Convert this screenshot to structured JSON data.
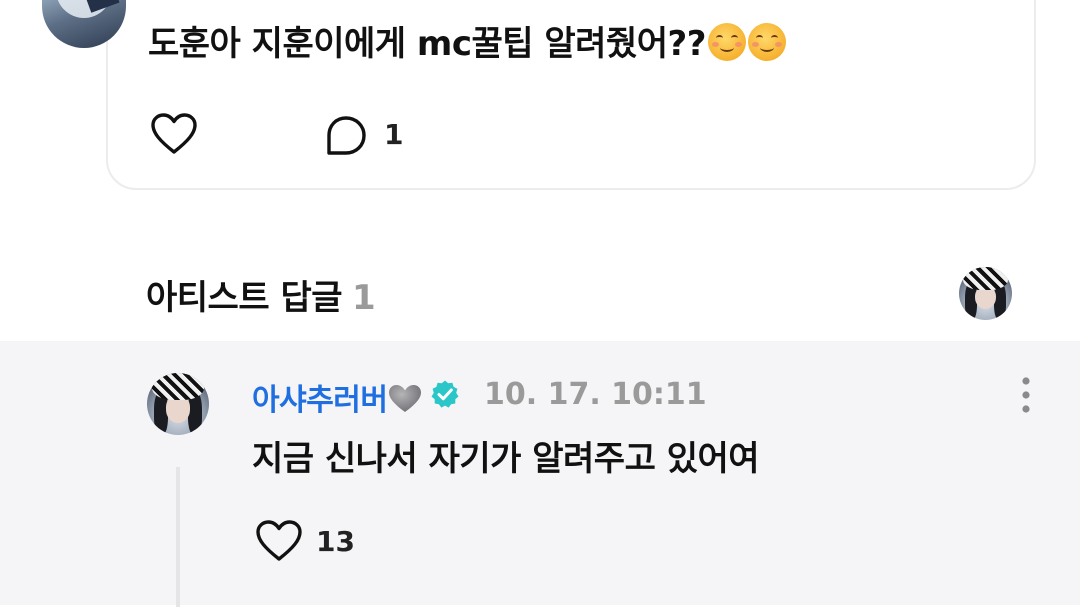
{
  "post": {
    "text": "도훈아 지훈이에게 mc꿀팁 알려줬어??",
    "emojis": [
      "smiling-face-icon",
      "smiling-face-icon"
    ],
    "comment_count": "1"
  },
  "section": {
    "title": "아티스트 답글",
    "count": "1"
  },
  "reply": {
    "author": "아샤추러버",
    "author_suffix_emoji": "grey-heart-icon",
    "verified": true,
    "timestamp": "10. 17. 10:11",
    "text": "지금 신나서 자기가 알려주고 있어여",
    "like_count": "13"
  },
  "colors": {
    "author_name": "#1f6fe0",
    "verified_badge": "#2ac6c8",
    "muted_text": "#9a9a9a",
    "reply_panel_bg": "#f5f5f7",
    "card_border": "#ececec"
  }
}
